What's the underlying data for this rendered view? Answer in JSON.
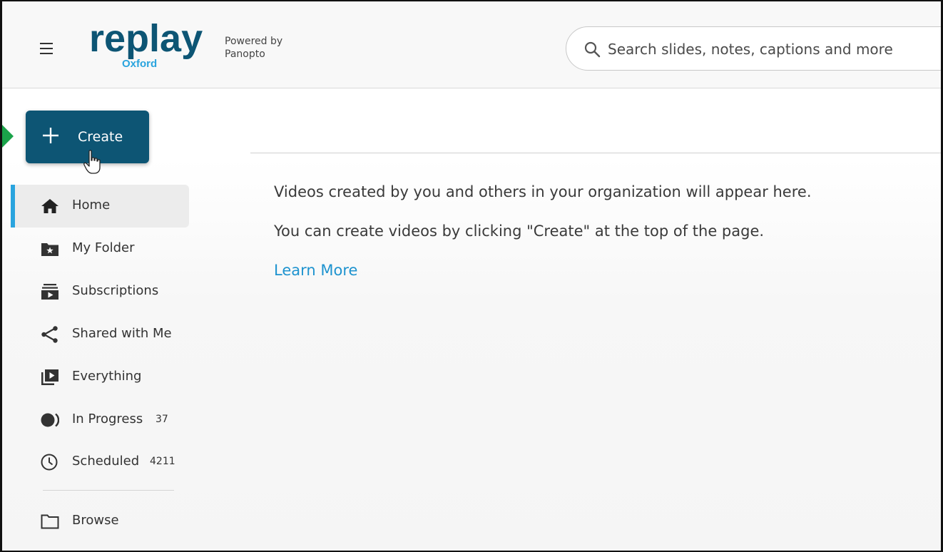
{
  "header": {
    "logo_text": "replay",
    "logo_sub": "Oxford",
    "powered_line1": "Powered by",
    "powered_line2": "Panopto",
    "search_placeholder": "Search slides, notes, captions and more"
  },
  "create_button": {
    "label": "Create"
  },
  "sidebar": {
    "items": [
      {
        "label": "Home",
        "icon": "home-icon",
        "active": true
      },
      {
        "label": "My Folder",
        "icon": "star-folder-icon"
      },
      {
        "label": "Subscriptions",
        "icon": "subscriptions-icon"
      },
      {
        "label": "Shared with Me",
        "icon": "share-icon"
      },
      {
        "label": "Everything",
        "icon": "play-library-icon"
      },
      {
        "label": "In Progress",
        "icon": "in-progress-icon",
        "count": "37"
      },
      {
        "label": "Scheduled",
        "icon": "clock-icon",
        "count": "4211"
      },
      {
        "label": "Browse",
        "icon": "folder-icon"
      }
    ]
  },
  "main": {
    "message_line1": "Videos created by you and others in your organization will appear here.",
    "message_line2": "You can create videos by clicking \"Create\" at the top of the page.",
    "learn_more": "Learn More"
  },
  "colors": {
    "create_bg": "#0d5574",
    "active_indicator": "#2aa4de",
    "link": "#1e93cf",
    "annotation_arrow": "#1aa34a",
    "logo": "#0d5574",
    "logo_sub": "#2aa4de"
  }
}
